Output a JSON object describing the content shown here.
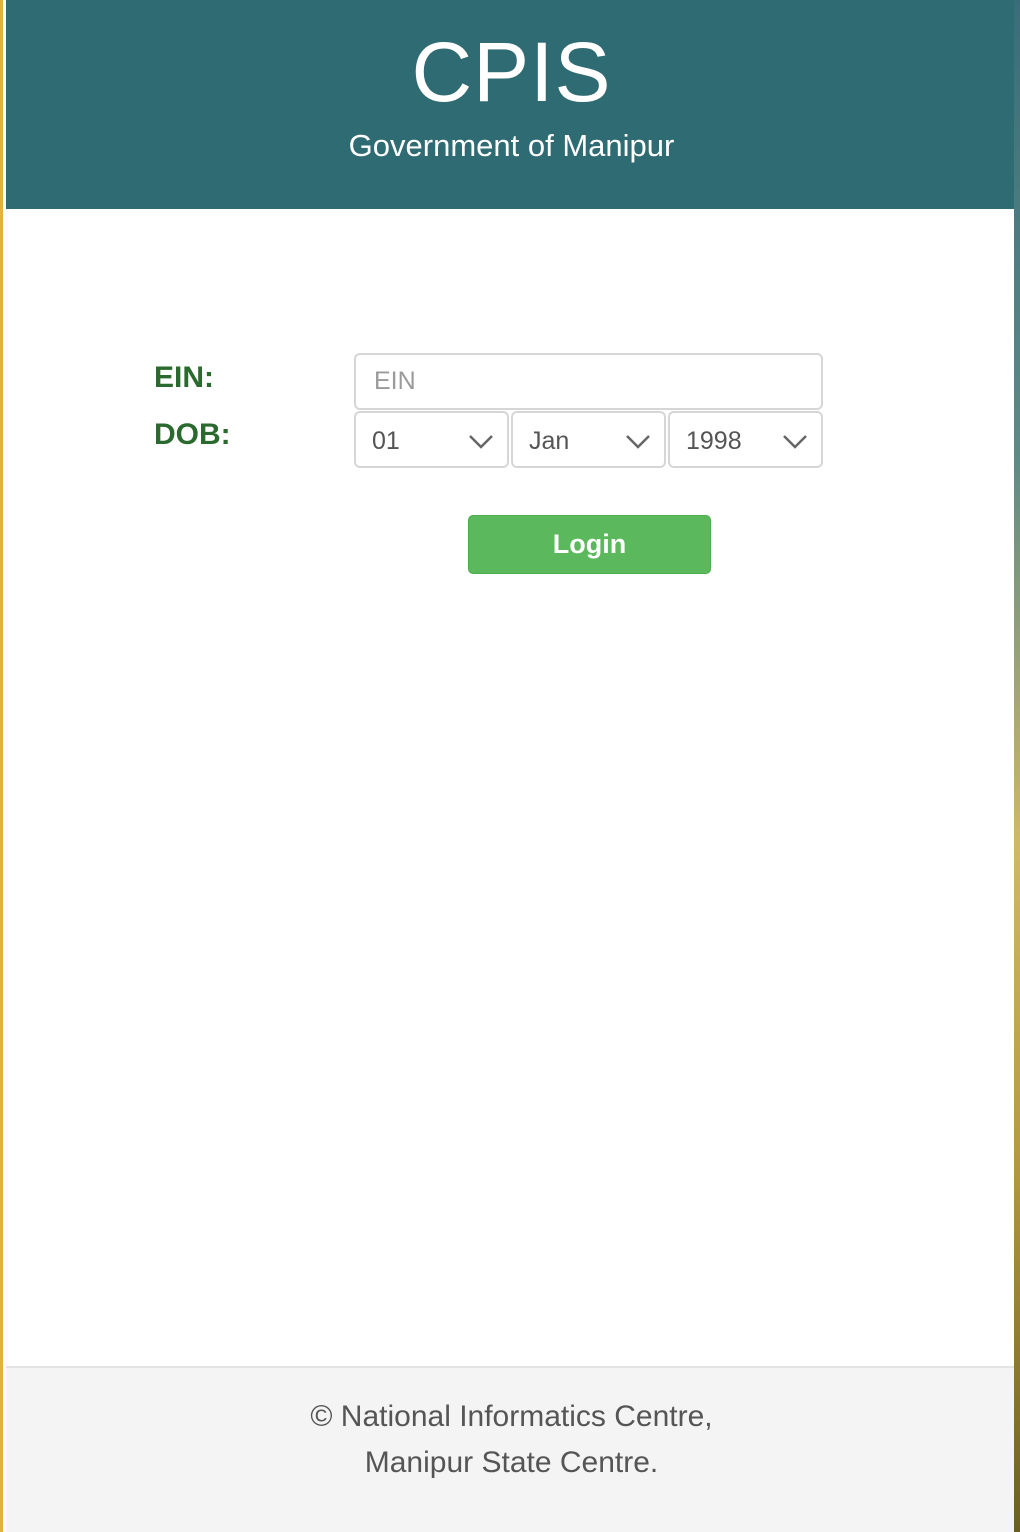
{
  "header": {
    "title": "CPIS",
    "subtitle": "Government of Manipur"
  },
  "form": {
    "ein_label": "EIN:",
    "ein_placeholder": "EIN",
    "dob_label": "DOB:",
    "dob_day": "01",
    "dob_month": "Jan",
    "dob_year": "1998",
    "login_label": "Login"
  },
  "footer": {
    "line1": "© National Informatics Centre,",
    "line2": "Manipur State Centre."
  },
  "colors": {
    "header_bg": "#2f6b72",
    "label": "#2b6a2e",
    "button": "#5cb85c",
    "footer_bg": "#f4f4f4"
  }
}
